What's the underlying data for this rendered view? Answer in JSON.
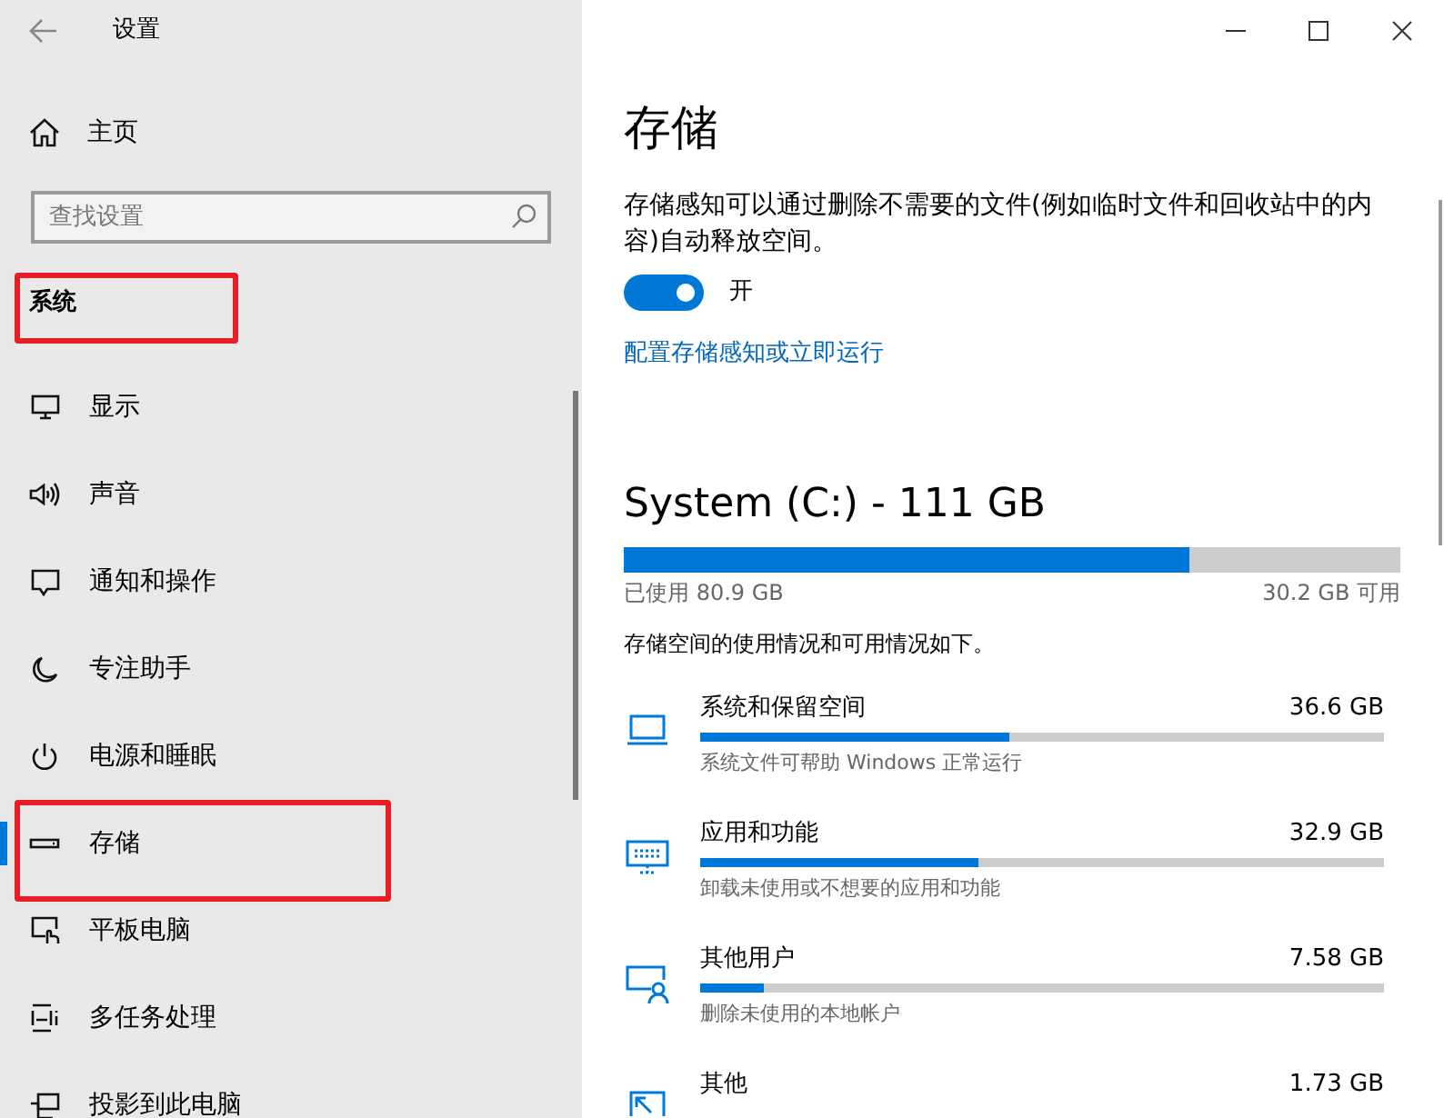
{
  "window": {
    "title": "设置"
  },
  "sidebar": {
    "home": "主页",
    "search": {
      "placeholder": "查找设置"
    },
    "section": {
      "label": "系统",
      "annotated": true
    },
    "items": [
      {
        "label": "显示",
        "selected": false,
        "annotated": false
      },
      {
        "label": "声音",
        "selected": false,
        "annotated": false
      },
      {
        "label": "通知和操作",
        "selected": false,
        "annotated": false
      },
      {
        "label": "专注助手",
        "selected": false,
        "annotated": false
      },
      {
        "label": "电源和睡眠",
        "selected": false,
        "annotated": false
      },
      {
        "label": "存储",
        "selected": true,
        "annotated": true
      },
      {
        "label": "平板电脑",
        "selected": false,
        "annotated": false
      },
      {
        "label": "多任务处理",
        "selected": false,
        "annotated": false
      },
      {
        "label": "投影到此电脑",
        "selected": false,
        "annotated": false
      }
    ]
  },
  "page": {
    "title": "存储",
    "description": "存储感知可以通过删除不需要的文件(例如临时文件和回收站中的内容)自动释放空间。",
    "toggle": {
      "on": true,
      "label": "开"
    },
    "link": "配置存储感知或立即运行",
    "drive": {
      "title": "System (C:) - 111 GB",
      "level": 0.729,
      "used": "已使用 80.9 GB",
      "free": "30.2 GB 可用"
    },
    "summary": "存储空间的使用情况和可用情况如下。",
    "categories": [
      {
        "name": "系统和保留空间",
        "size": "36.6 GB",
        "level": 0.452,
        "hint": "系统文件可帮助 Windows 正常运行"
      },
      {
        "name": "应用和功能",
        "size": "32.9 GB",
        "level": 0.407,
        "hint": "卸载未使用或不想要的应用和功能"
      },
      {
        "name": "其他用户",
        "size": "7.58 GB",
        "level": 0.093,
        "hint": "删除未使用的本地帐户"
      },
      {
        "name": "其他",
        "size": "1.73 GB"
      }
    ]
  }
}
